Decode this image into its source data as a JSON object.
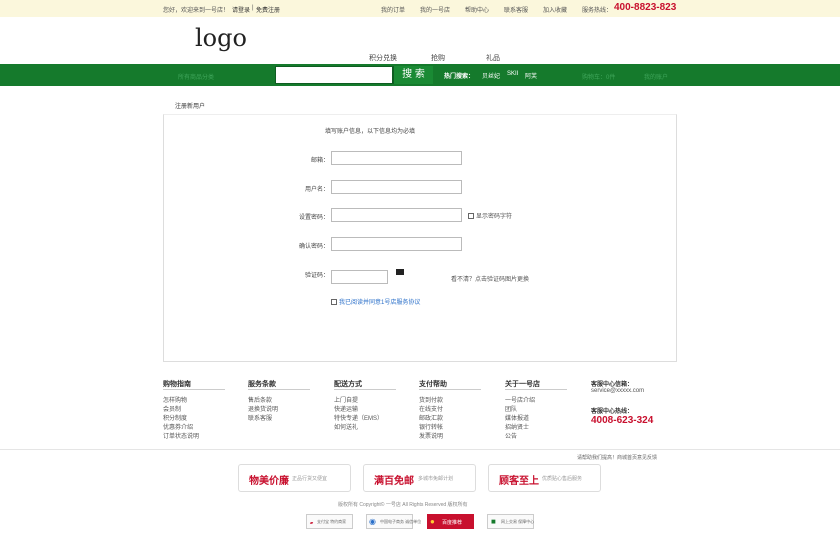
{
  "topbar": {
    "greeting": "您好，欢迎来到一号店！",
    "login": "请登录",
    "sep": "|",
    "register": "免费注册",
    "links": [
      "我的订单",
      "我的一号店",
      "帮助中心",
      "联系客服",
      "加入收藏"
    ],
    "hotline_label": "服务热线：",
    "hotline_number": "400-8823-823"
  },
  "logo": "logo",
  "nav": {
    "items": [
      "积分兑换",
      "抢购",
      "礼品"
    ]
  },
  "searchbar": {
    "category_label": "所有商品分类",
    "search_button": "搜 索",
    "hot_label": "热门搜索：",
    "hot_items": [
      "贝丝妃",
      "SKII",
      "阿芙"
    ],
    "cart_label": "购物车：0件",
    "account_label": "我的账户"
  },
  "page_title": "注册新用户",
  "form": {
    "intro": "填写账户信息，以下信息均为必填",
    "email_label": "邮箱：",
    "username_label": "用户名：",
    "password_label": "设置密码：",
    "show_password_label": "显示密码字符",
    "confirm_label": "确认密码：",
    "captcha_label": "验证码：",
    "captcha_hint": "看不清？点击验证码图片更换",
    "agreement_label": "我已阅读并同意1号店服务协议"
  },
  "footer": {
    "columns": [
      {
        "title": "购物指南",
        "items": [
          "怎样购物",
          "会员制",
          "积分制度",
          "优惠券介绍",
          "订单状态说明"
        ]
      },
      {
        "title": "服务条款",
        "items": [
          "售后条款",
          "退换货说明",
          "联系客服"
        ]
      },
      {
        "title": "配送方式",
        "items": [
          "上门自提",
          "快递运输",
          "特快专递（EMS）",
          "如何送礼"
        ]
      },
      {
        "title": "支付帮助",
        "items": [
          "货到付款",
          "在线支付",
          "邮政汇款",
          "银行转帐",
          "发票说明"
        ]
      },
      {
        "title": "关于一号店",
        "items": [
          "一号店介绍",
          "团队",
          "媒体报道",
          "招纳贤士",
          "公告"
        ]
      }
    ],
    "service_email_title": "客服中心信箱：",
    "service_email": "service@xxxxx.com",
    "service_phone_title": "客服中心热线：",
    "service_phone": "4008-623-324",
    "feedback": "请帮助我们提高！商城首页意见反馈",
    "badges": [
      {
        "big": "物美价廉",
        "small": "正品行货又便宜"
      },
      {
        "big": "满百免邮",
        "small": "多城市免邮计划"
      },
      {
        "big": "顾客至上",
        "small": "优质贴心售后服务"
      }
    ],
    "copyright": "版权所有 Copyright© 一号店 All Rights Reserved 版权所有",
    "certs": [
      "支付宝 特约商家",
      "中国电子商务 诚信单位",
      "百度推荐",
      "网上交易 保障中心"
    ]
  }
}
